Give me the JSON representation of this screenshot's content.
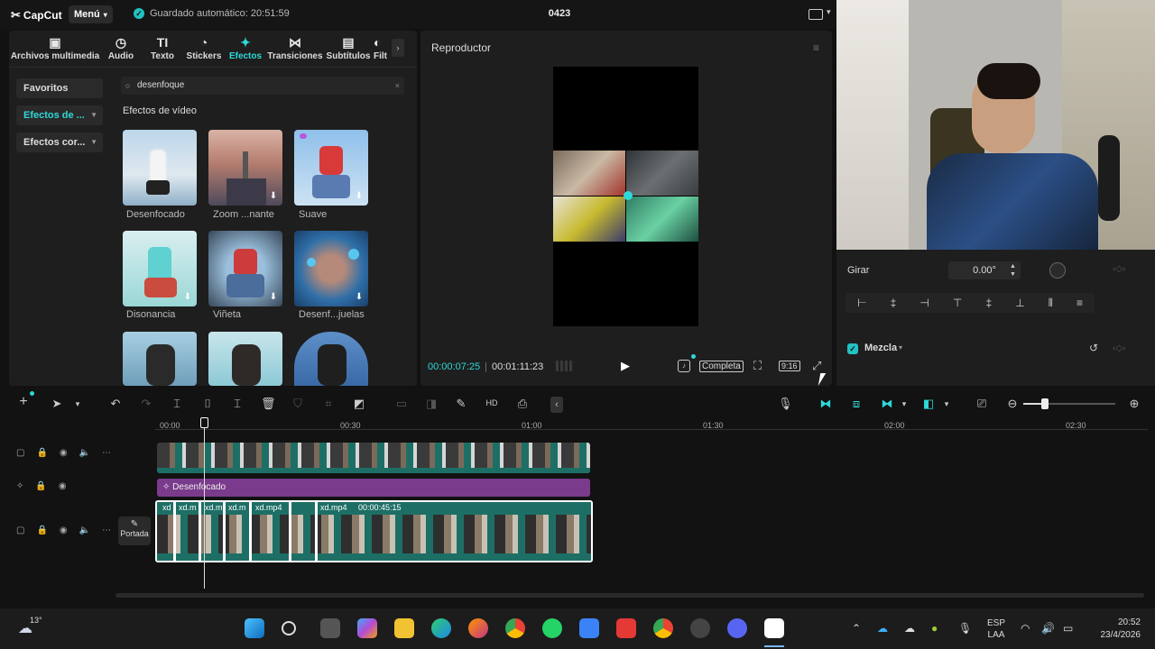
{
  "app": {
    "logo": "CapCut",
    "menu_label": "Menú",
    "autosave": "Guardado automático: 20:51:59",
    "project_name": "0423"
  },
  "tabs": [
    {
      "label": "Archivos multimedia",
      "icon": "media-icon"
    },
    {
      "label": "Audio",
      "icon": "audio-icon"
    },
    {
      "label": "Texto",
      "icon": "text-icon"
    },
    {
      "label": "Stickers",
      "icon": "sticker-icon"
    },
    {
      "label": "Efectos",
      "icon": "effects-icon"
    },
    {
      "label": "Transiciones",
      "icon": "transition-icon"
    },
    {
      "label": "Subtítulos",
      "icon": "subtitle-icon"
    },
    {
      "label": "Filt",
      "icon": "filter-icon"
    }
  ],
  "sidebar": {
    "items": [
      {
        "label": "Favoritos"
      },
      {
        "label": "Efectos de ..."
      },
      {
        "label": "Efectos cor..."
      }
    ]
  },
  "search": {
    "value": "desenfoque"
  },
  "effects_section_title": "Efectos de vídeo",
  "effects": [
    {
      "label": "Desenfocado"
    },
    {
      "label": "Zoom ...nante"
    },
    {
      "label": "Suave"
    },
    {
      "label": "Disonancia"
    },
    {
      "label": "Viñeta"
    },
    {
      "label": "Desenf...juelas"
    }
  ],
  "player": {
    "title": "Reproductor",
    "time_current": "00:00:07:25",
    "time_total": "00:01:11:23",
    "fit_label": "Completa",
    "ratio_label": "9:16"
  },
  "properties": {
    "rotate_label": "Girar",
    "rotate_value": "0.00°",
    "blend_label": "Mezcla"
  },
  "timeline": {
    "ticks": [
      "00:00",
      "00:30",
      "01:00",
      "01:30",
      "02:00",
      "02:30"
    ],
    "effect_track_label": "Desenfocado",
    "cover_label": "Portada",
    "clip_labels": [
      "xd",
      "xd.m",
      "xd.m",
      "xd.m",
      "xd.mp4",
      "xd.mp4",
      "00:00:45:15"
    ]
  },
  "taskbar": {
    "weather": "13°",
    "lang_top": "ESP",
    "lang_bottom": "LAA",
    "time": "20:52",
    "date": "23/4/2026"
  },
  "colors": {
    "accent": "#2fd8d8",
    "effect_track": "#7a3b8c",
    "clip_teal": "#1d6f66"
  }
}
